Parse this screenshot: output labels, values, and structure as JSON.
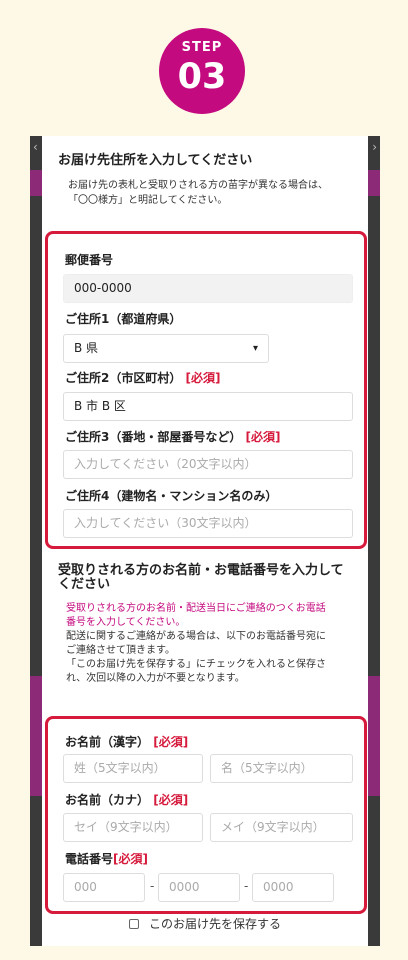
{
  "step": {
    "label": "STEP",
    "number": "03"
  },
  "address": {
    "heading": "お届け先住所を入力してください",
    "note_lines": [
      "お届け先の表札と受取りされる方の苗字が異なる場合は、",
      "「〇〇様方」と明記してください。"
    ],
    "postal": {
      "label": "郵便番号",
      "value": "000-0000"
    },
    "pref": {
      "label": "ご住所1（都道府県）",
      "value": "B 県"
    },
    "city": {
      "label": "ご住所2（市区町村）",
      "required": "[必須]",
      "value": "B 市 B 区"
    },
    "street": {
      "label": "ご住所3（番地・部屋番号など）",
      "required": "[必須]",
      "placeholder": "入力してください（20文字以内）"
    },
    "building": {
      "label": "ご住所4（建物名・マンション名のみ）",
      "placeholder": "入力してください（30文字以内）"
    }
  },
  "recipient": {
    "heading_lines": [
      "受取りされる方のお名前・お電話番号を入力して",
      "ください"
    ],
    "pink_lines": [
      "受取りされる方のお名前・配送当日にご連絡のつくお電話",
      "番号を入力してください。"
    ],
    "note_lines": [
      "配送に関するご連絡がある場合は、以下のお電話番号宛に",
      "ご連絡させて頂きます。",
      "「このお届け先を保存する」にチェックを入れると保存さ",
      "れ、次回以降の入力が不要となります。"
    ],
    "kanji": {
      "label": "お名前（漢字）",
      "required": "[必須]",
      "last_ph": "姓（5文字以内）",
      "first_ph": "名（5文字以内）"
    },
    "kana": {
      "label": "お名前（カナ）",
      "required": "[必須]",
      "last_ph": "セイ（9文字以内）",
      "first_ph": "メイ（9文字以内）"
    },
    "phone": {
      "label": "電話番号",
      "required": "[必須]",
      "p1": "000",
      "p2": "0000",
      "p3": "0000",
      "sep": "-"
    }
  },
  "save_label": "このお届け先を保存する",
  "colors": {
    "accent": "#c40a7f",
    "frame": "#d61a3c",
    "page_bg": "#fdf9e6"
  }
}
